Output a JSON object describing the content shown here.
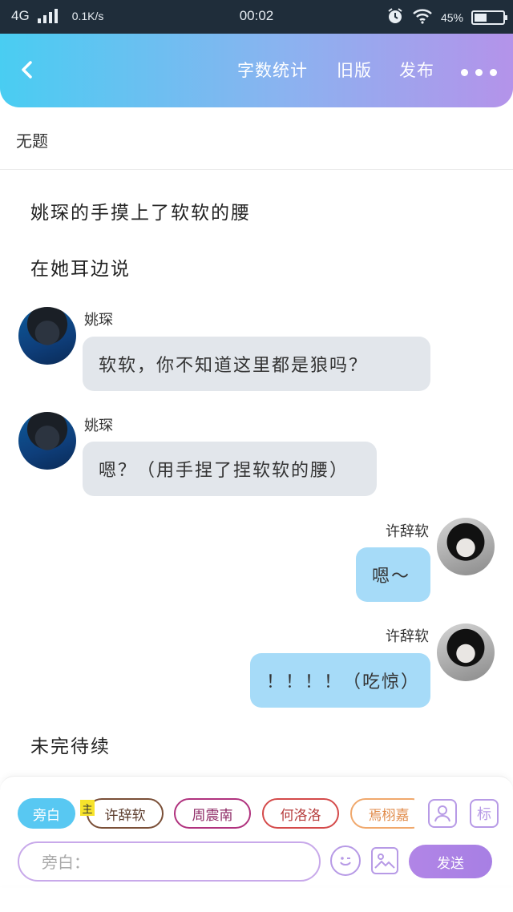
{
  "status_bar": {
    "network": "4G",
    "speed": "0.1K/s",
    "time": "00:02",
    "battery": "45%",
    "battery_level": 0.45
  },
  "header": {
    "word_count_label": "字数统计",
    "old_version_label": "旧版",
    "publish_label": "发布",
    "accent_start": "#49cdf2",
    "accent_end": "#b493ea"
  },
  "title": "无题",
  "story": {
    "narration": [
      "姚琛的手摸上了软软的腰",
      "在她耳边说",
      "未完待续"
    ],
    "messages": [
      {
        "sender": "姚琛",
        "side": "left",
        "text": "软软，你不知道这里都是狼吗？"
      },
      {
        "sender": "姚琛",
        "side": "left",
        "text": "嗯？（用手捏了捏软软的腰）"
      },
      {
        "sender": "许辞软",
        "side": "right",
        "text": "嗯～"
      },
      {
        "sender": "许辞软",
        "side": "right",
        "text": "！！！！（吃惊）"
      }
    ]
  },
  "composer": {
    "role_chips": [
      {
        "label": "旁白",
        "active": true
      },
      {
        "label": "许辞软",
        "tag": "主"
      },
      {
        "label": "周震南"
      },
      {
        "label": "何洛洛"
      },
      {
        "label": "焉栩嘉"
      }
    ],
    "mark_label": "标",
    "input_placeholder": "旁白：",
    "send_label": "发送"
  }
}
